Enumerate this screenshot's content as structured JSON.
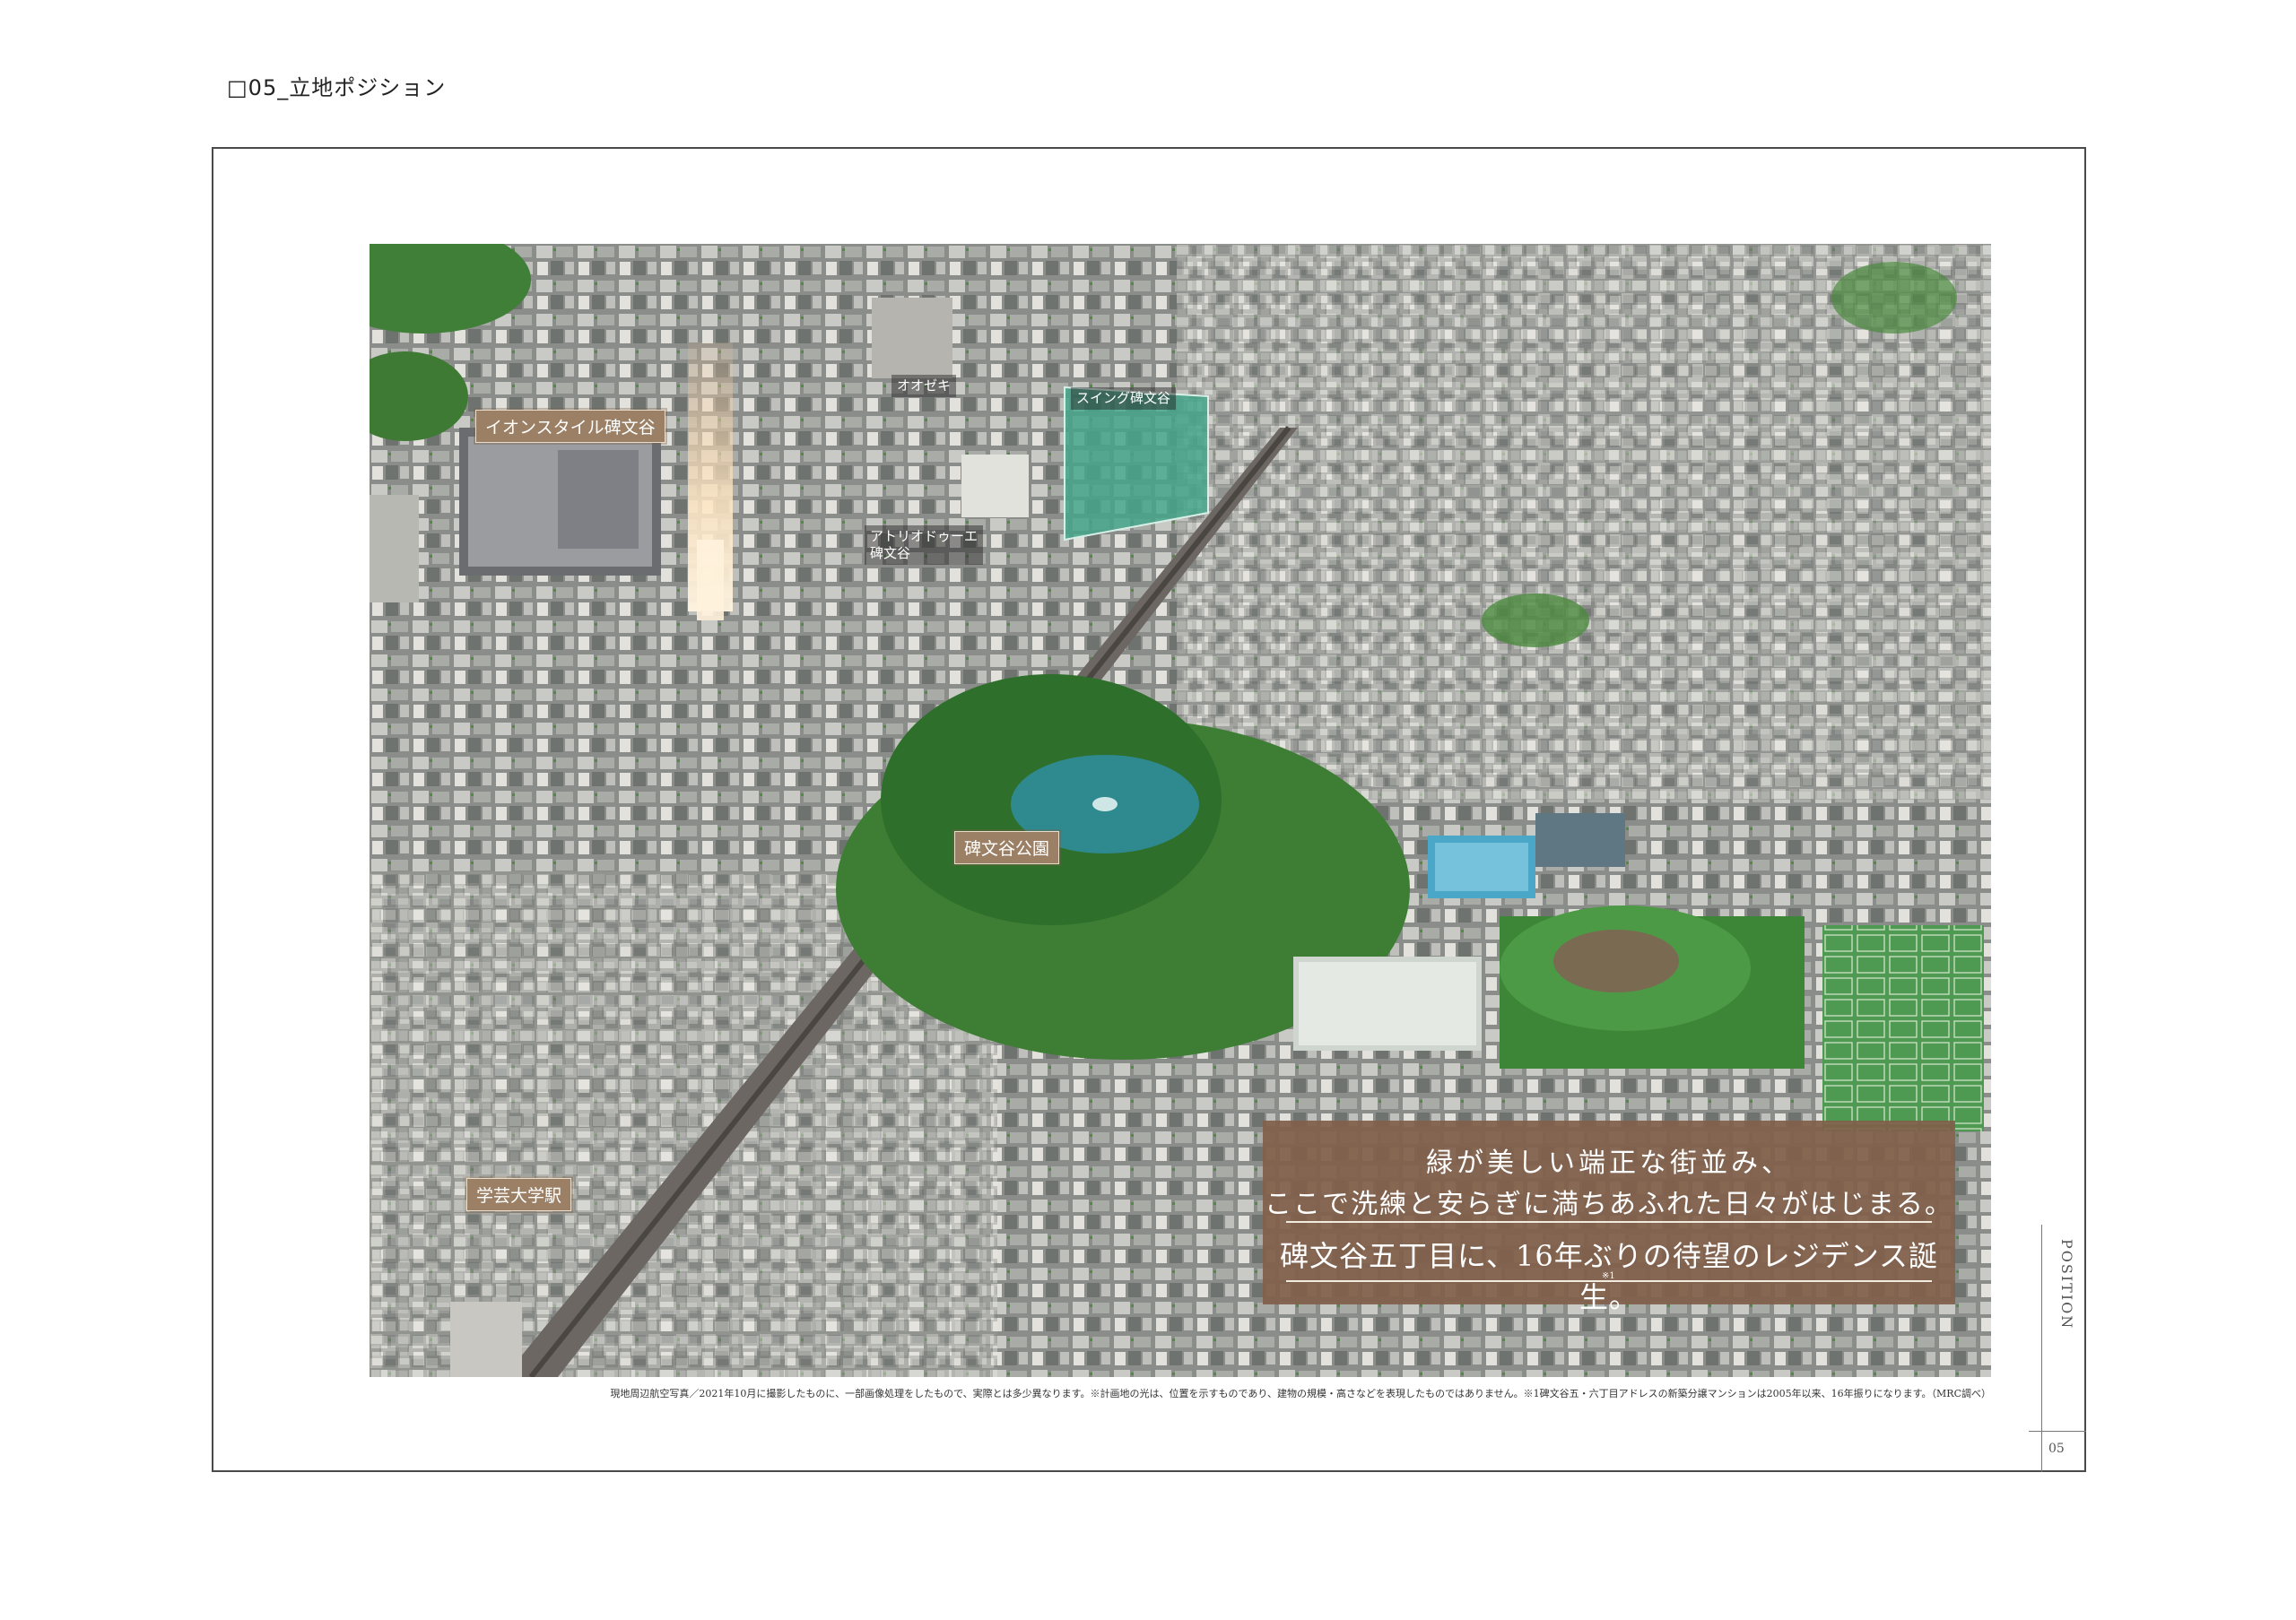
{
  "header": {
    "section_title": "□05_立地ポジション"
  },
  "photo": {
    "labels": {
      "aeon": "イオンスタイル碑文谷",
      "ozeki": "オオゼキ",
      "swing": "スイング碑文谷",
      "atelier_line1": "アトリオドゥーエ",
      "atelier_line2": "碑文谷",
      "park": "碑文谷公園",
      "station": "学芸大学駅"
    }
  },
  "headline": {
    "line1": "緑が美しい端正な街並み、",
    "line2": "ここで洗練と安らぎに満ちあふれた日々がはじまる。",
    "line3": "碑文谷五丁目に、16年ぶりの待望のレジデンス誕生。",
    "note_mark": "※1"
  },
  "caption": "現地周辺航空写真／2021年10月に撮影したものに、一部画像処理をしたもので、実際とは多少異なります。※計画地の光は、位置を示すものであり、建物の規模・高さなどを表現したものではありません。※1碑文谷五・六丁目アドレスの新築分譲マンションは2005年以来、16年振りになります。（MRC調べ）",
  "side": {
    "section_label": "POSITION",
    "page_number": "05"
  },
  "colors": {
    "label_bg": "#9b8066",
    "headline_bg": "#80604a",
    "frame": "#4a4a4a"
  }
}
